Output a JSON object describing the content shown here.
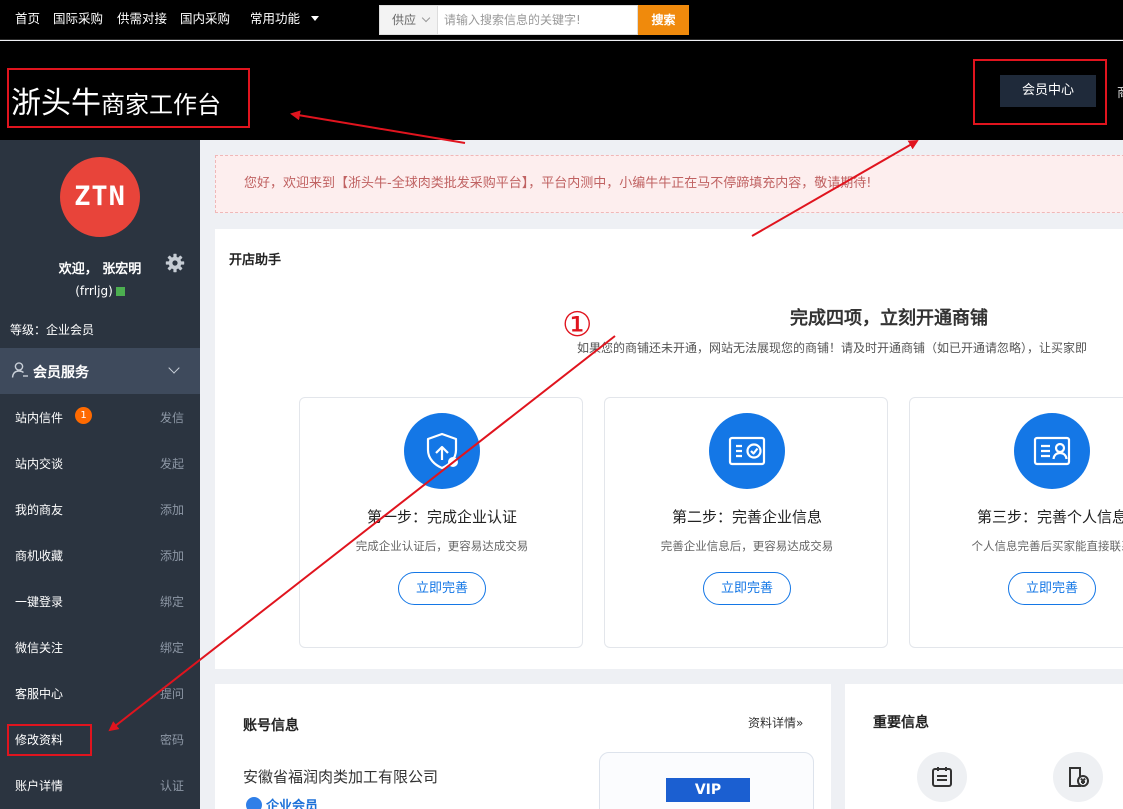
{
  "topnav": {
    "links": [
      "首页",
      "国际采购",
      "供需对接",
      "国内采购",
      "常用功能"
    ],
    "search_select": "供应",
    "search_placeholder": "请输入搜索信息的关键字!",
    "search_button": "搜索"
  },
  "header": {
    "brand_main": "浙头牛",
    "brand_sub": "商家工作台",
    "member_center": "会员中心",
    "cut_text": "商"
  },
  "sidebar": {
    "avatar_text": "ZTN",
    "welcome": "欢迎， 张宏明",
    "username": "(frrljg)",
    "level": "等级：企业会员",
    "service_header": "会员服务",
    "items": [
      {
        "label": "站内信件",
        "action": "发信",
        "badge": "1"
      },
      {
        "label": "站内交谈",
        "action": "发起"
      },
      {
        "label": "我的商友",
        "action": "添加"
      },
      {
        "label": "商机收藏",
        "action": "添加"
      },
      {
        "label": "一键登录",
        "action": "绑定"
      },
      {
        "label": "微信关注",
        "action": "绑定"
      },
      {
        "label": "客服中心",
        "action": "提问"
      },
      {
        "label": "修改资料",
        "action": "密码"
      },
      {
        "label": "账户详情",
        "action": "认证"
      }
    ]
  },
  "notice": "您好，欢迎来到【浙头牛-全球肉类批发采购平台】，平台内测中，小编牛牛正在马不停蹄填充内容，敬请期待!",
  "assistant": {
    "title": "开店助手",
    "headline": "完成四项，立刻开通商铺",
    "subtext": "如果您的商铺还未开通，网站无法展现您的商铺！请及时开通商铺（如已开通请忽略），让买家即",
    "steps": [
      {
        "title": "第一步：完成企业认证",
        "desc": "完成企业认证后，更容易达成交易",
        "button": "立即完善",
        "icon": "shield-upload-icon"
      },
      {
        "title": "第二步：完善企业信息",
        "desc": "完善企业信息后，更容易达成交易",
        "button": "立即完善",
        "icon": "certificate-icon"
      },
      {
        "title": "第三步：完善个人信息",
        "desc": "个人信息完善后买家能直接联系",
        "button": "立即完善",
        "icon": "id-card-icon"
      }
    ]
  },
  "account": {
    "title": "账号信息",
    "more": "资料详情»",
    "company": "安徽省福润肉类加工有限公司",
    "member_type": "企业会员",
    "vip": "VIP"
  },
  "important": {
    "title": "重要信息"
  },
  "annotation": {
    "marker": "①"
  },
  "colors": {
    "accent_blue": "#1477e6",
    "search_orange": "#f08a0c",
    "sidebar_bg": "#2b3440",
    "annotation_red": "#e0141e",
    "avatar_red": "#e8443a"
  }
}
